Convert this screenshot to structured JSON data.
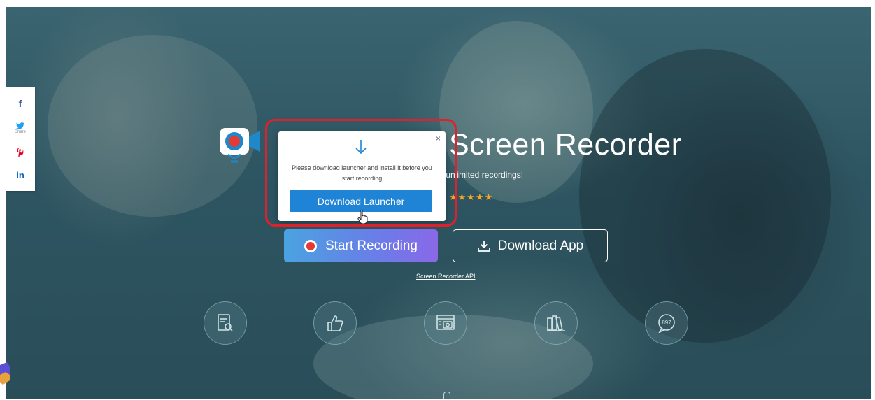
{
  "social": {
    "facebook_glyph": "f",
    "twitter_glyph": "🐦",
    "share_label": "Share",
    "pinterest_glyph": "P",
    "linkedin_glyph": "in"
  },
  "hero": {
    "title_visible": "Screen Recorder",
    "subtitle_visible": "r unlimited recordings!",
    "stars": "★★★★★"
  },
  "modal": {
    "close_glyph": "×",
    "message": "Please download launcher and install it before you start recording",
    "button_label": "Download Launcher"
  },
  "actions": {
    "start_label": "Start Recording",
    "download_label": "Download App",
    "api_link": "Screen Recorder API"
  },
  "features": {
    "comment_count": "897"
  },
  "colors": {
    "accent_blue": "#1f83d6",
    "record_red": "#e53935",
    "highlight_red": "#e0202a",
    "star_gold": "#f5a623"
  }
}
